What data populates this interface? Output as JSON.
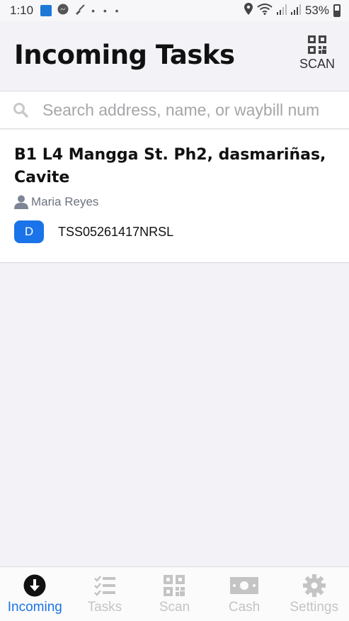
{
  "status_bar": {
    "time": "1:10",
    "battery": "53%"
  },
  "header": {
    "title": "Incoming Tasks",
    "scan_label": "SCAN"
  },
  "search": {
    "placeholder": "Search address, name, or waybill num"
  },
  "tasks": [
    {
      "address": "B1 L4 Mangga St. Ph2, dasmariñas, Cavite",
      "recipient": "Maria Reyes",
      "badge": "D",
      "waybill": "TSS05261417NRSL"
    }
  ],
  "nav": {
    "tabs": [
      {
        "label": "Incoming",
        "icon": "download-circle-icon",
        "active": true
      },
      {
        "label": "Tasks",
        "icon": "checklist-icon",
        "active": false
      },
      {
        "label": "Scan",
        "icon": "qr-code-icon",
        "active": false
      },
      {
        "label": "Cash",
        "icon": "cash-icon",
        "active": false
      },
      {
        "label": "Settings",
        "icon": "gear-icon",
        "active": false
      }
    ]
  },
  "colors": {
    "accent": "#1a73e8",
    "inactive": "#c4c4c4",
    "background": "#f2f2f7"
  }
}
